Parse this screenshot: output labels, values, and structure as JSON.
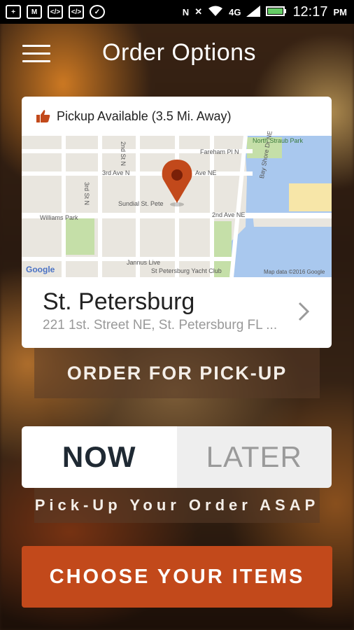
{
  "status_bar": {
    "network": "4G",
    "time": "12:17",
    "ampm": "PM"
  },
  "header": {
    "title": "Order Options"
  },
  "location_card": {
    "pickup_label": "Pickup Available (3.5 Mi. Away)",
    "map_labels": {
      "north_straub_park": "North Straub Park",
      "fareham": "Fareham Pl N",
      "third_ave_n": "3rd Ave N",
      "third_ave_ne": "Ave NE",
      "second_st_n": "2nd St N",
      "third_st_n": "3rd St N",
      "sundial": "Sundial St. Pete",
      "second_ave_ne": "2nd Ave NE",
      "bay_shore": "Bay Shore Dr NE",
      "williams_park": "Williams Park",
      "jannus": "Jannus Live",
      "yacht_club": "St Petersburg Yacht Club",
      "google": "Google",
      "map_data": "Map data ©2016 Google"
    },
    "store_name": "St. Petersburg",
    "store_address": "221 1st. Street NE, St. Petersburg FL ..."
  },
  "buttons": {
    "order_pickup": "ORDER FOR PICK-UP",
    "now": "NOW",
    "later": "LATER",
    "asap_text": "Pick-Up Your Order ASAP",
    "choose_items": "CHOOSE YOUR ITEMS"
  },
  "colors": {
    "accent": "#c2491b",
    "pin": "#c2491b"
  }
}
